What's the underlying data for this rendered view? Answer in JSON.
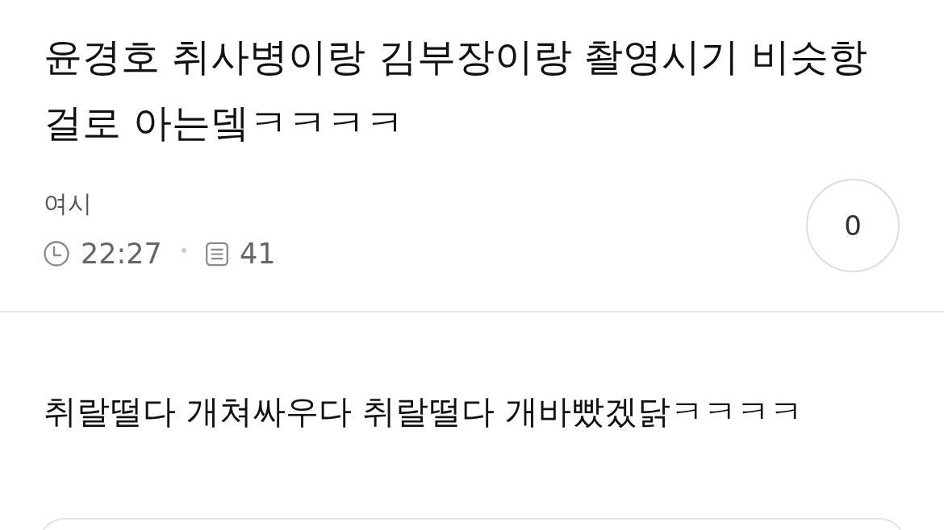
{
  "post": {
    "title": "윤경호 취사병이랑 김부장이랑 촬영시기 비슷항 걸로 아는뎈ㅋㅋㅋㅋ",
    "author": "여시",
    "time": "22:27",
    "comment_count": "41",
    "vote_count": "0"
  },
  "body": {
    "text": "취랄떨다 개쳐싸우다 취랄떨다 개바빴겠닭ㅋㅋㅋㅋ"
  }
}
